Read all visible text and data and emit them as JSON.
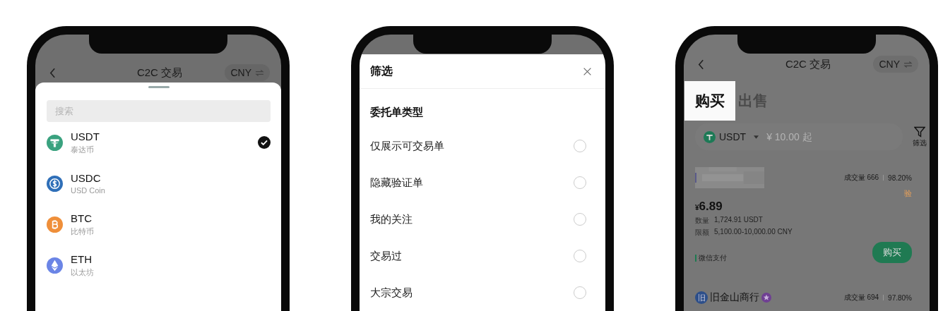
{
  "phones": [
    {
      "kind": "coin_picker",
      "header": {
        "title": "C2C 交易",
        "currency": "CNY"
      },
      "search": {
        "placeholder": "搜索"
      },
      "coins": [
        {
          "kind": "tether",
          "symbol": "USDT",
          "name": "泰达币",
          "color": "#3aa27f",
          "selected": true
        },
        {
          "kind": "dollar",
          "symbol": "USDC",
          "name": "USD Coin",
          "color": "#2f6fb8",
          "selected": false
        },
        {
          "kind": "bitcoin",
          "symbol": "BTC",
          "name": "比特币",
          "color": "#ef8f3a",
          "selected": false
        },
        {
          "kind": "ether",
          "symbol": "ETH",
          "name": "以太坊",
          "color": "#6b85e6",
          "selected": false
        }
      ]
    },
    {
      "kind": "filter_sheet",
      "title": "筛选",
      "section": "委托单类型",
      "options": [
        {
          "label": "仅展示可交易单",
          "selected": false
        },
        {
          "label": "隐藏验证单",
          "selected": false
        },
        {
          "label": "我的关注",
          "selected": false
        },
        {
          "label": "交易过",
          "selected": false
        },
        {
          "label": "大宗交易",
          "selected": false
        }
      ]
    },
    {
      "kind": "market",
      "header": {
        "title": "C2C 交易",
        "currency": "CNY"
      },
      "tabs": [
        {
          "label": "购买",
          "selected": true
        },
        {
          "label": "出售",
          "selected": false
        }
      ],
      "coin": "USDT",
      "amount": {
        "placeholder": "¥ 10.00 起"
      },
      "filter_label": "筛选",
      "ads": [
        {
          "kind": "full",
          "volume": "成交量 666",
          "rate": "98.20%",
          "badge": "验",
          "price_currency": "¥",
          "price": "6.89",
          "quantity_label": "数量",
          "quantity": "1,724.91 USDT",
          "limit_label": "限额",
          "limit": "5,100.00-10,000.00 CNY",
          "payment": "微信支付",
          "button": "购买"
        },
        {
          "kind": "partial",
          "merchant_initial": "旧",
          "merchant": "旧金山商行",
          "volume": "成交量 694",
          "rate": "97.80%"
        }
      ]
    }
  ]
}
